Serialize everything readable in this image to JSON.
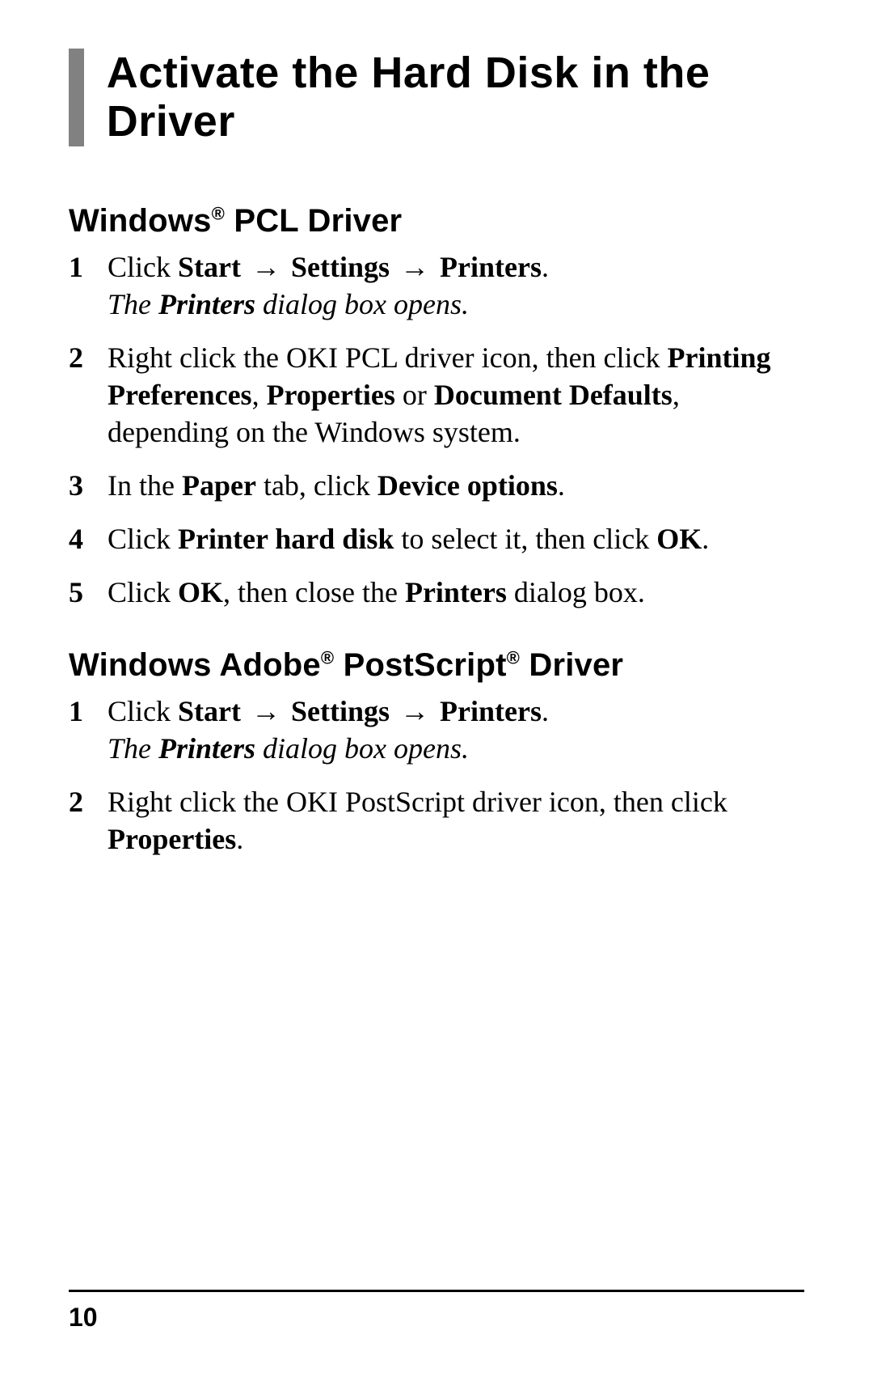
{
  "title": "Activate the Hard Disk in the Driver",
  "page_number": "10",
  "section1": {
    "heading_pre": "Windows",
    "heading_sup": "®",
    "heading_post": " PCL Driver",
    "steps": [
      {
        "num": "1",
        "parts": [
          {
            "t": "Click ",
            "cls": ""
          },
          {
            "t": "Start",
            "cls": "bold"
          },
          {
            "t": " → ",
            "cls": "arrow"
          },
          {
            "t": "Settings",
            "cls": "bold"
          },
          {
            "t": " → ",
            "cls": "arrow"
          },
          {
            "t": "Printers",
            "cls": "bold"
          },
          {
            "t": ".",
            "cls": ""
          }
        ],
        "note": [
          {
            "t": "The ",
            "cls": "ital"
          },
          {
            "t": "Printers",
            "cls": "italbold"
          },
          {
            "t": " dialog box opens.",
            "cls": "ital"
          }
        ]
      },
      {
        "num": "2",
        "parts": [
          {
            "t": "Right click the OKI PCL driver icon, then click ",
            "cls": ""
          },
          {
            "t": "Printing Preferences",
            "cls": "bold"
          },
          {
            "t": ", ",
            "cls": ""
          },
          {
            "t": "Properties",
            "cls": "bold"
          },
          {
            "t": " or ",
            "cls": ""
          },
          {
            "t": "Document Defaults",
            "cls": "bold"
          },
          {
            "t": ", depending on the Windows system.",
            "cls": ""
          }
        ]
      },
      {
        "num": "3",
        "parts": [
          {
            "t": "In the ",
            "cls": ""
          },
          {
            "t": "Paper",
            "cls": "bold"
          },
          {
            "t": " tab, click ",
            "cls": ""
          },
          {
            "t": "Device options",
            "cls": "bold"
          },
          {
            "t": ".",
            "cls": ""
          }
        ]
      },
      {
        "num": "4",
        "parts": [
          {
            "t": "Click ",
            "cls": ""
          },
          {
            "t": "Printer hard disk",
            "cls": "bold"
          },
          {
            "t": " to select it, then click ",
            "cls": ""
          },
          {
            "t": "OK",
            "cls": "bold"
          },
          {
            "t": ".",
            "cls": ""
          }
        ]
      },
      {
        "num": "5",
        "parts": [
          {
            "t": "Click ",
            "cls": ""
          },
          {
            "t": "OK",
            "cls": "bold"
          },
          {
            "t": ", then close the ",
            "cls": ""
          },
          {
            "t": "Printers",
            "cls": "bold"
          },
          {
            "t": " dialog box.",
            "cls": ""
          }
        ]
      }
    ]
  },
  "section2": {
    "heading_pre": "Windows Adobe",
    "heading_sup1": "®",
    "heading_mid": " PostScript",
    "heading_sup2": "®",
    "heading_post": " Driver",
    "steps": [
      {
        "num": "1",
        "parts": [
          {
            "t": "Click ",
            "cls": ""
          },
          {
            "t": "Start",
            "cls": "bold"
          },
          {
            "t": " → ",
            "cls": "arrow"
          },
          {
            "t": "Settings",
            "cls": "bold"
          },
          {
            "t": " → ",
            "cls": "arrow"
          },
          {
            "t": "Printers",
            "cls": "bold"
          },
          {
            "t": ".",
            "cls": ""
          }
        ],
        "note": [
          {
            "t": "The ",
            "cls": "ital"
          },
          {
            "t": "Printers",
            "cls": "italbold"
          },
          {
            "t": " dialog box opens.",
            "cls": "ital"
          }
        ]
      },
      {
        "num": "2",
        "parts": [
          {
            "t": "Right click the OKI PostScript driver icon, then click ",
            "cls": ""
          },
          {
            "t": "Properties",
            "cls": "bold"
          },
          {
            "t": ".",
            "cls": ""
          }
        ]
      }
    ]
  }
}
